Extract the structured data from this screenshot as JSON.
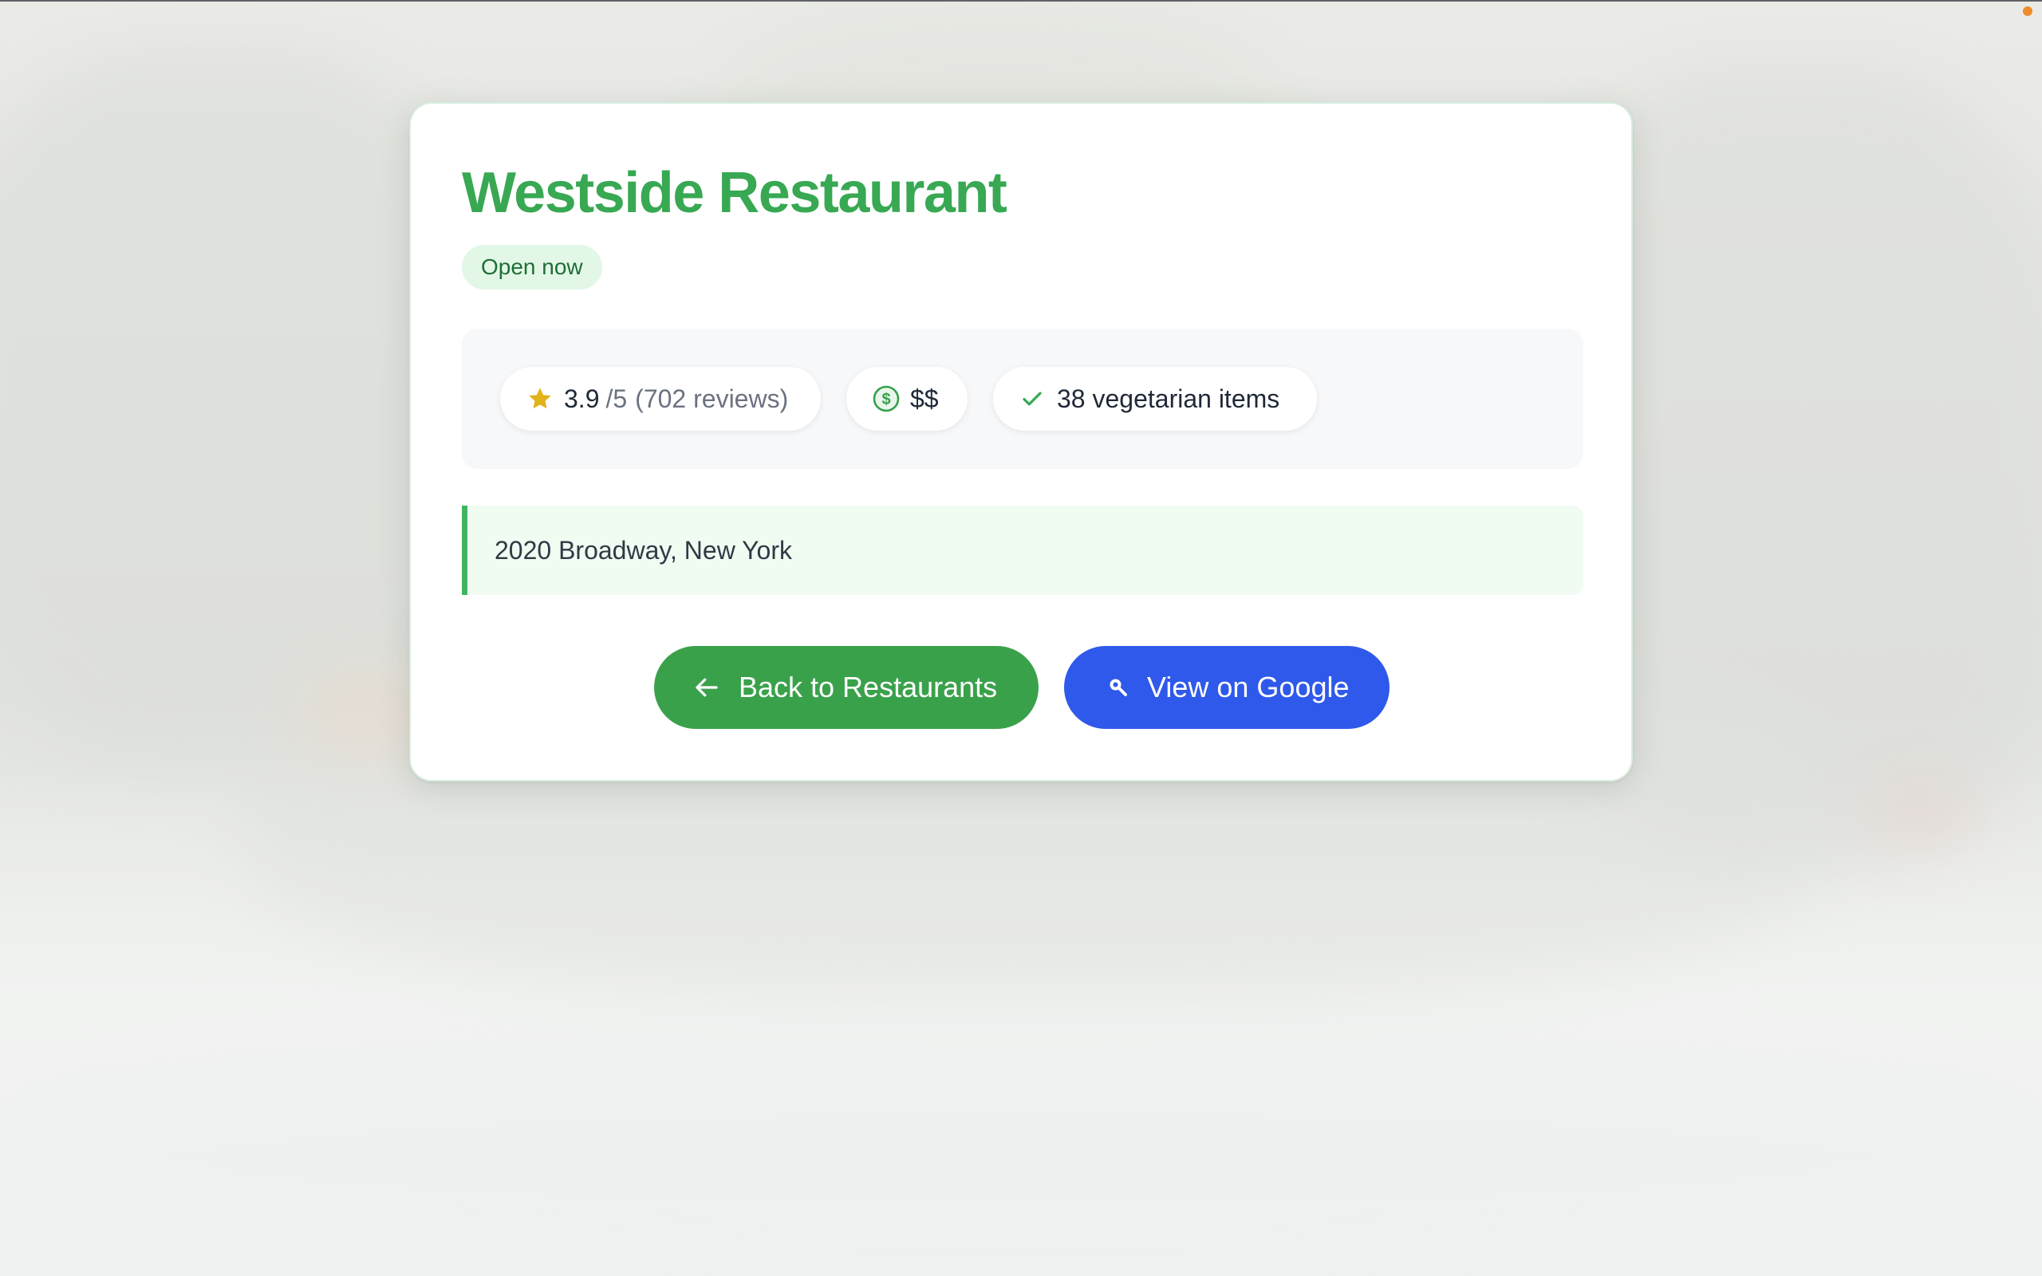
{
  "restaurant": {
    "name": "Westside Restaurant",
    "status": "Open now",
    "address": "2020 Broadway, New York"
  },
  "rating": {
    "value": "3.9",
    "scale": "/5",
    "reviews": "(702 reviews)",
    "icon": "star-icon"
  },
  "price": {
    "level": "$$",
    "icon": "dollar-circle-icon"
  },
  "vegetarian": {
    "label": "38 vegetarian items",
    "icon": "check-icon"
  },
  "actions": {
    "back_label": "Back to Restaurants",
    "back_icon": "arrow-left-icon",
    "google_label": "View on Google",
    "google_icon": "search-icon"
  },
  "colors": {
    "title": "#38a853",
    "status_bg": "#e3f7e7",
    "back_button": "#3aa14b",
    "google_button": "#2f59ea",
    "star": "#e2b21b",
    "accent_border": "#3fb560"
  }
}
